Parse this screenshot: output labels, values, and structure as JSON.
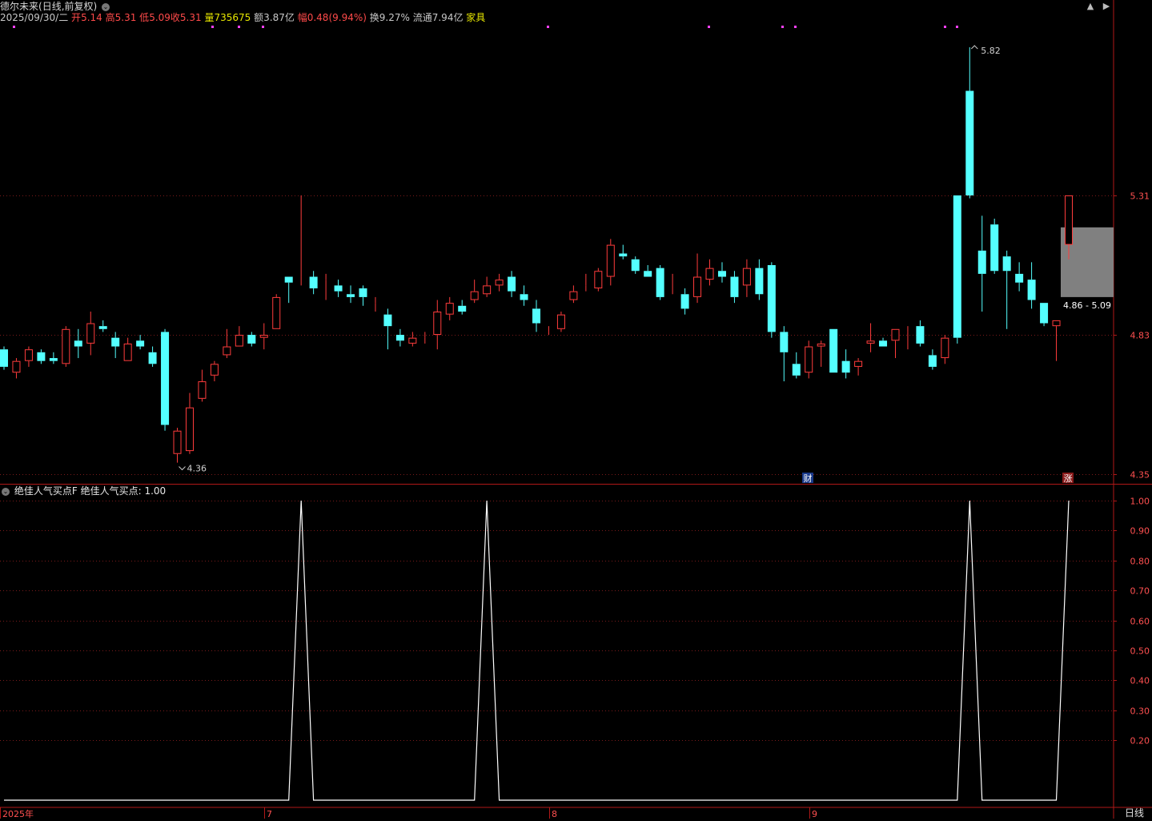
{
  "header": {
    "stock_name": "德尔未来",
    "period_label": "(日线,前复权)",
    "date": "2025/09/30/二",
    "open_label": "开",
    "open": "5.14",
    "high_label": "高",
    "high": "5.31",
    "low_label": "低",
    "low": "5.09",
    "close_label": "收",
    "close": "5.31",
    "volume_label": "量",
    "volume": "735675",
    "amount_label": "额",
    "amount": "3.87亿",
    "change_label": "幅",
    "change": "0.48(9.94%)",
    "turnover_label": "换",
    "turnover": "9.27%",
    "float_label": "流通",
    "float_cap": "7.94亿",
    "sector": "家具"
  },
  "window_buttons": {
    "prev": "▲",
    "next": "▶"
  },
  "price_axis": {
    "ticks": [
      5.31,
      4.83,
      4.35
    ],
    "max_label": "5.82",
    "min_label": "4.36",
    "range_label": "4.86 - 5.09"
  },
  "markers": {
    "finance": "财",
    "limit_up": "涨"
  },
  "indicator": {
    "name": "绝佳人气买点F",
    "series_label": "绝佳人气买点:",
    "value": "1.00",
    "ticks": [
      "1.00",
      "0.90",
      "0.80",
      "0.70",
      "0.60",
      "0.50",
      "0.40",
      "0.30",
      "0.20"
    ]
  },
  "time_axis": {
    "labels": [
      "2025年",
      "7",
      "8",
      "9"
    ]
  },
  "bottom_tab": "日线",
  "colors": {
    "up": "#ff3c3c",
    "down": "#54ffff",
    "axis": "#b01818",
    "text": "#c8c8c8",
    "selection": "#808080"
  },
  "chart_data": [
    {
      "type": "candlestick",
      "title": "",
      "ylim": [
        4.32,
        5.9
      ],
      "candles": [
        [
          4.78,
          4.72,
          4.79,
          4.71
        ],
        [
          4.7,
          4.74,
          4.75,
          4.68
        ],
        [
          4.74,
          4.78,
          4.79,
          4.72
        ],
        [
          4.77,
          4.74,
          4.78,
          4.73
        ],
        [
          4.75,
          4.74,
          4.77,
          4.73
        ],
        [
          4.73,
          4.85,
          4.86,
          4.72
        ],
        [
          4.81,
          4.79,
          4.85,
          4.75
        ],
        [
          4.8,
          4.87,
          4.91,
          4.76
        ],
        [
          4.86,
          4.85,
          4.88,
          4.84
        ],
        [
          4.82,
          4.79,
          4.84,
          4.75
        ],
        [
          4.74,
          4.8,
          4.82,
          4.74
        ],
        [
          4.81,
          4.79,
          4.83,
          4.78
        ],
        [
          4.77,
          4.73,
          4.79,
          4.72
        ],
        [
          4.84,
          4.52,
          4.85,
          4.5
        ],
        [
          4.42,
          4.5,
          4.51,
          4.39
        ],
        [
          4.43,
          4.58,
          4.63,
          4.42
        ],
        [
          4.61,
          4.67,
          4.71,
          4.6
        ],
        [
          4.69,
          4.73,
          4.74,
          4.67
        ],
        [
          4.76,
          4.79,
          4.85,
          4.75
        ],
        [
          4.79,
          4.83,
          4.86,
          4.79
        ],
        [
          4.83,
          4.8,
          4.84,
          4.79
        ],
        [
          4.82,
          4.83,
          4.87,
          4.78
        ],
        [
          4.85,
          4.96,
          4.97,
          4.85
        ],
        [
          5.03,
          5.01,
          5.03,
          4.94
        ],
        [
          5.03,
          5.03,
          5.31,
          5.0
        ],
        [
          5.03,
          4.99,
          5.05,
          4.97
        ],
        [
          5.02,
          5.02,
          5.04,
          4.95
        ],
        [
          5.0,
          4.98,
          5.02,
          4.96
        ],
        [
          4.97,
          4.96,
          5.0,
          4.94
        ],
        [
          4.99,
          4.96,
          5.0,
          4.93
        ],
        [
          4.94,
          4.94,
          4.96,
          4.91
        ],
        [
          4.9,
          4.86,
          4.92,
          4.78
        ],
        [
          4.83,
          4.81,
          4.85,
          4.79
        ],
        [
          4.8,
          4.82,
          4.84,
          4.79
        ],
        [
          4.82,
          4.82,
          4.84,
          4.8
        ],
        [
          4.83,
          4.91,
          4.95,
          4.78
        ],
        [
          4.9,
          4.94,
          4.96,
          4.88
        ],
        [
          4.93,
          4.91,
          4.95,
          4.9
        ],
        [
          4.95,
          4.98,
          5.02,
          4.94
        ],
        [
          4.97,
          5.0,
          5.03,
          4.96
        ],
        [
          5.0,
          5.02,
          5.04,
          4.98
        ],
        [
          5.03,
          4.98,
          5.05,
          4.96
        ],
        [
          4.97,
          4.95,
          5.0,
          4.93
        ],
        [
          4.92,
          4.87,
          4.95,
          4.84
        ],
        [
          4.84,
          4.84,
          4.86,
          4.83
        ],
        [
          4.85,
          4.9,
          4.91,
          4.84
        ],
        [
          4.95,
          4.98,
          5.0,
          4.94
        ],
        [
          5.0,
          5.0,
          5.04,
          4.98
        ],
        [
          4.99,
          5.05,
          5.06,
          4.98
        ],
        [
          5.03,
          5.14,
          5.16,
          5.0
        ],
        [
          5.11,
          5.1,
          5.14,
          5.09
        ],
        [
          5.09,
          5.05,
          5.1,
          5.04
        ],
        [
          5.05,
          5.03,
          5.07,
          5.03
        ],
        [
          5.06,
          4.96,
          5.07,
          4.95
        ],
        [
          4.97,
          4.97,
          5.04,
          4.97
        ],
        [
          4.97,
          4.92,
          4.99,
          4.9
        ],
        [
          4.96,
          5.03,
          5.11,
          4.94
        ],
        [
          5.02,
          5.06,
          5.09,
          5.0
        ],
        [
          5.05,
          5.03,
          5.08,
          5.01
        ],
        [
          5.03,
          4.96,
          5.05,
          4.94
        ],
        [
          5.0,
          5.06,
          5.09,
          4.96
        ],
        [
          5.06,
          4.97,
          5.09,
          4.95
        ],
        [
          5.07,
          4.84,
          5.08,
          4.82
        ],
        [
          4.84,
          4.77,
          4.86,
          4.67
        ],
        [
          4.73,
          4.69,
          4.77,
          4.68
        ],
        [
          4.7,
          4.79,
          4.81,
          4.68
        ],
        [
          4.79,
          4.8,
          4.81,
          4.72
        ],
        [
          4.85,
          4.7,
          4.85,
          4.7
        ],
        [
          4.74,
          4.7,
          4.78,
          4.68
        ],
        [
          4.72,
          4.74,
          4.75,
          4.69
        ],
        [
          4.8,
          4.81,
          4.87,
          4.77
        ],
        [
          4.81,
          4.79,
          4.82,
          4.79
        ],
        [
          4.81,
          4.85,
          4.85,
          4.75
        ],
        [
          4.84,
          4.84,
          4.86,
          4.78
        ],
        [
          4.86,
          4.8,
          4.88,
          4.79
        ],
        [
          4.76,
          4.72,
          4.78,
          4.71
        ],
        [
          4.75,
          4.82,
          4.83,
          4.73
        ],
        [
          5.31,
          4.82,
          5.31,
          4.8
        ],
        [
          5.67,
          5.31,
          5.82,
          5.3
        ],
        [
          5.12,
          5.04,
          5.24,
          4.91
        ],
        [
          5.21,
          5.05,
          5.23,
          5.04
        ],
        [
          5.1,
          5.05,
          5.12,
          4.85
        ],
        [
          5.04,
          5.01,
          5.08,
          4.98
        ],
        [
          5.02,
          4.95,
          5.08,
          4.92
        ],
        [
          4.94,
          4.87,
          4.94,
          4.86
        ],
        [
          4.86,
          4.88,
          4.88,
          4.74
        ],
        [
          5.14,
          5.31,
          5.31,
          5.09
        ]
      ]
    },
    {
      "type": "line",
      "title": "绝佳人气买点F",
      "ylim": [
        0,
        1.0
      ],
      "series": [
        {
          "name": "绝佳人气买点",
          "values": [
            0,
            0,
            0,
            0,
            0,
            0,
            0,
            0,
            0,
            0,
            0,
            0,
            0,
            0,
            0,
            0,
            0,
            0,
            0,
            0,
            0,
            0,
            0,
            0,
            1,
            0,
            0,
            0,
            0,
            0,
            0,
            0,
            0,
            0,
            0,
            0,
            0,
            0,
            0,
            1,
            0,
            0,
            0,
            0,
            0,
            0,
            0,
            0,
            0,
            0,
            0,
            0,
            0,
            0,
            0,
            0,
            0,
            0,
            0,
            0,
            0,
            0,
            0,
            0,
            0,
            0,
            0,
            0,
            0,
            0,
            0,
            0,
            0,
            0,
            0,
            0,
            0,
            0,
            1,
            0,
            0,
            0,
            0,
            0,
            0,
            0,
            1
          ]
        }
      ]
    }
  ]
}
